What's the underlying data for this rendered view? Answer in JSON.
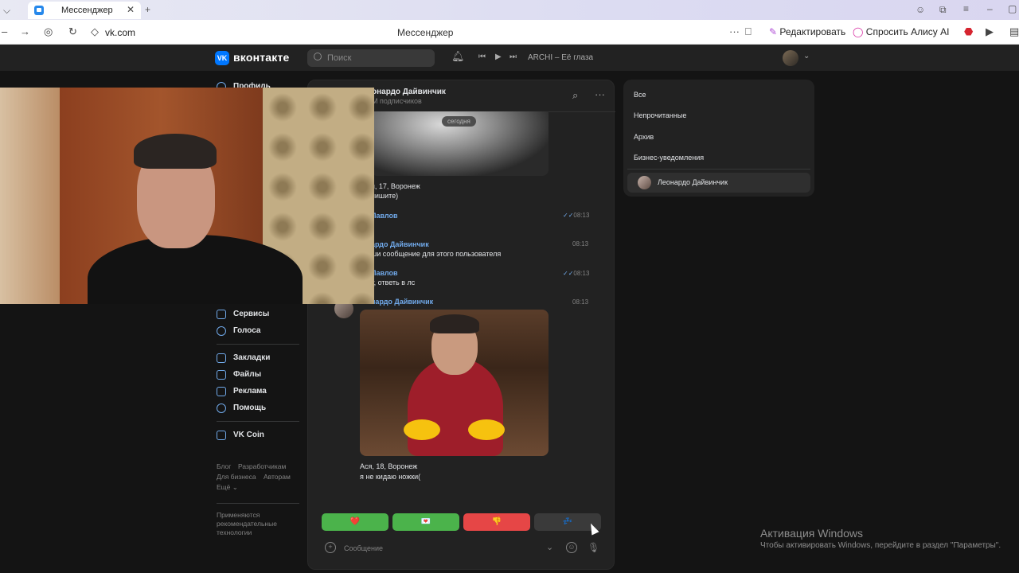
{
  "browser": {
    "tab_title": "Мессенджер",
    "url": "vk.com",
    "page_title": "Мессенджер",
    "edit_label": "Редактировать",
    "alice_label": "Спросить Алису AI"
  },
  "vk": {
    "logo_text": "вконтакте",
    "search_placeholder": "Поиск",
    "track": "ARCHI – Её глаза"
  },
  "left_menu": {
    "profile": "Профиль",
    "services": "Сервисы",
    "voices": "Голоса",
    "bookmarks": "Закладки",
    "files": "Файлы",
    "ads": "Реклама",
    "help": "Помощь",
    "vkcoin": "VK Coin",
    "footer": [
      "Блог",
      "Разработчикам",
      "Для бизнеса",
      "Авторам",
      "Ещё ⌄"
    ],
    "notice": [
      "Применяются",
      "рекомендательные",
      "технологии"
    ]
  },
  "chat": {
    "name": "онардо Дайвинчик",
    "subscribers": "М подписчиков",
    "date": "сегодня",
    "messages": [
      {
        "name": "",
        "text": "я, 17, Воронеж",
        "time": ""
      },
      {
        "name": "",
        "text": "пишите)",
        "time": ""
      },
      {
        "name": "Павлов",
        "text": "",
        "time": "08:13"
      },
      {
        "name": "ардо Дайвинчик",
        "text": "ши сообщение для этого пользователя",
        "time": "08:13"
      },
      {
        "name": "Павлов",
        "text": "у, ответь в лс",
        "time": "08:13"
      },
      {
        "name": "нардо Дайвинчик",
        "text": "",
        "time": "08:13"
      },
      {
        "name": "",
        "text": "Ася, 18, Воронеж",
        "time": ""
      },
      {
        "name": "",
        "text": "я не кидаю ножки(",
        "time": ""
      }
    ],
    "keyboard": [
      "❤️",
      "💌",
      "👎",
      "💤"
    ],
    "input_placeholder": "Сообщение"
  },
  "filters": {
    "items": [
      "Все",
      "Непрочитанные",
      "Архив",
      "Бизнес-уведомления"
    ],
    "selected_chat": "Леонардо Дайвинчик"
  },
  "watermark": {
    "title": "Активация Windows",
    "text": "Чтобы активировать Windows, перейдите в раздел \"Параметры\"."
  },
  "colors": {
    "accent": "#71aaeb",
    "vk_blue": "#0077ff",
    "green": "#4bb34b",
    "red": "#e64646"
  }
}
